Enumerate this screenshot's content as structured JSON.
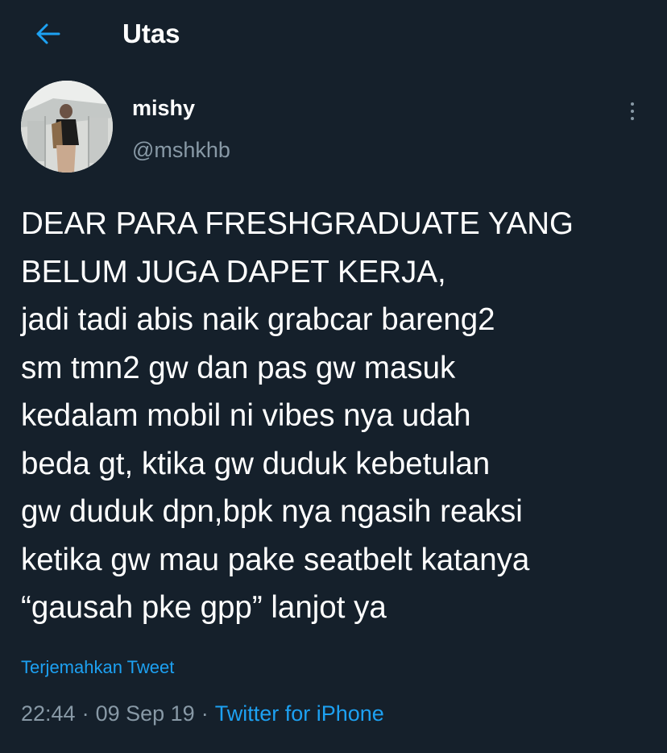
{
  "header": {
    "back_icon": "arrow-left-icon",
    "title": "Utas"
  },
  "author": {
    "name": "mishy",
    "handle": "@mshkhb",
    "more_icon": "more-vertical-icon"
  },
  "tweet": {
    "lines": [
      "DEAR PARA FRESHGRADUATE YANG",
      "BELUM JUGA DAPET KERJA,",
      "jadi tadi abis naik grabcar bareng2",
      "sm tmn2 gw dan pas gw masuk",
      "kedalam mobil ni vibes nya udah",
      "beda gt, ktika gw duduk kebetulan",
      "gw duduk dpn,bpk nya ngasih reaksi",
      "ketika gw mau pake seatbelt katanya",
      "“gausah pke gpp” lanjot ya"
    ],
    "translate_label": "Terjemahkan Tweet"
  },
  "meta": {
    "time": "22:44",
    "date": "09 Sep 19",
    "source": "Twitter for iPhone",
    "separator": "·"
  },
  "colors": {
    "background": "#15202b",
    "accent": "#1da1f2",
    "secondary_text": "#8899a6",
    "primary_text": "#ffffff"
  }
}
